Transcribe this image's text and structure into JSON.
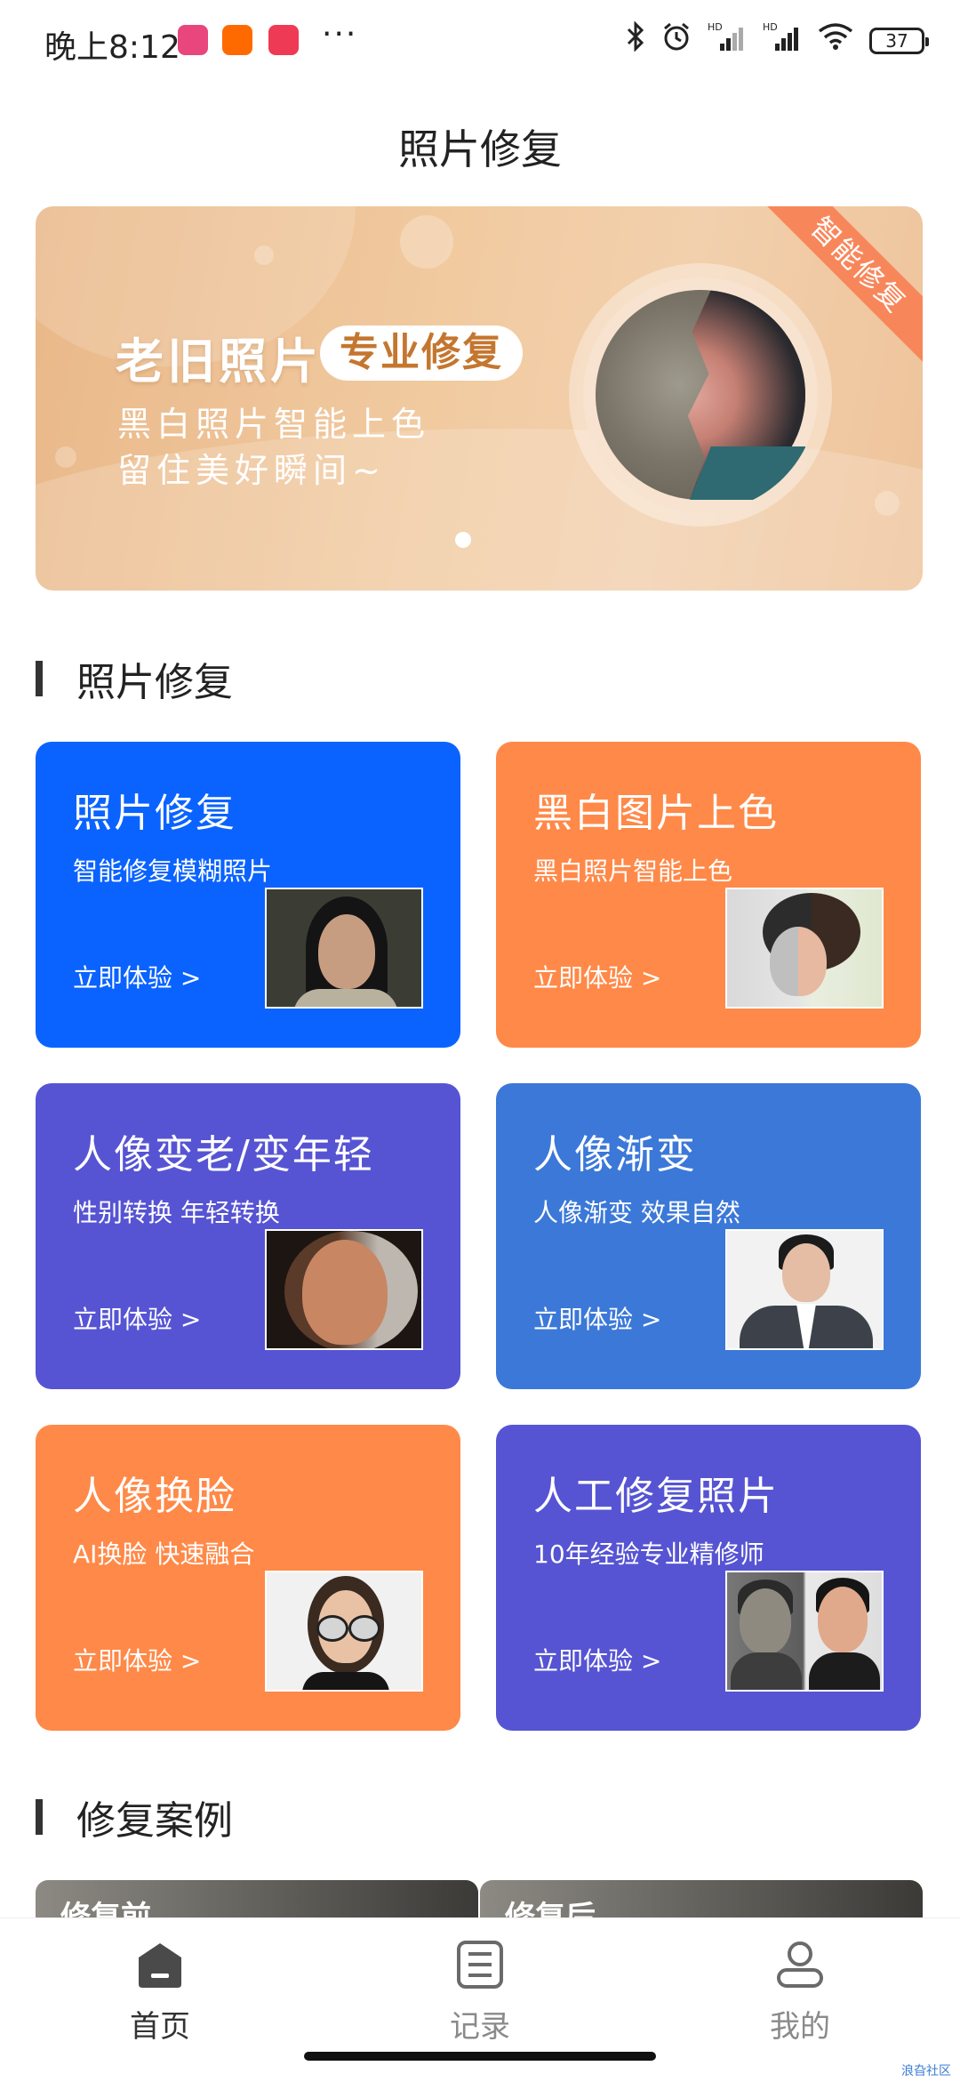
{
  "status_bar": {
    "time": "晚上8:12",
    "more": "···",
    "battery": "37",
    "icons": [
      "bluetooth-icon",
      "alarm-icon",
      "hd-signal-icon",
      "hd-signal-icon",
      "wifi-icon",
      "battery-icon"
    ]
  },
  "page": {
    "title": "照片修复"
  },
  "banner": {
    "title": "老旧照片",
    "pill": "专业修复",
    "line1": "黑白照片智能上色",
    "line2": "留住美好瞬间~",
    "ribbon": "智能修复",
    "colors": {
      "bg_start": "#e9b889",
      "bg_end": "#eec39a",
      "pill_text": "#c4762f",
      "ribbon": "#f7875b"
    }
  },
  "section_repair": {
    "title": "照片修复"
  },
  "cards": [
    {
      "title": "照片修复",
      "subtitle": "智能修复模糊照片",
      "cta": "立即体验 >",
      "color": "#0a63ff"
    },
    {
      "title": "黑白图片上色",
      "subtitle": "黑白照片智能上色",
      "cta": "立即体验 >",
      "color": "#ff8948"
    },
    {
      "title": "人像变老/变年轻",
      "subtitle": "性别转换 年轻转换",
      "cta": "立即体验 >",
      "color": "#5654d3"
    },
    {
      "title": "人像渐变",
      "subtitle": "人像渐变 效果自然",
      "cta": "立即体验 >",
      "color": "#3b78d8"
    },
    {
      "title": "人像换脸",
      "subtitle": "AI换脸 快速融合",
      "cta": "立即体验 >",
      "color": "#ff8948"
    },
    {
      "title": "人工修复照片",
      "subtitle": "10年经验专业精修师",
      "cta": "立即体验 >",
      "color": "#5654d3"
    }
  ],
  "section_cases": {
    "title": "修复案例"
  },
  "cases": {
    "before": "修复前",
    "after": "修复后"
  },
  "bottom_nav": {
    "items": [
      {
        "label": "首页",
        "icon": "home-icon",
        "active": true
      },
      {
        "label": "记录",
        "icon": "document-icon",
        "active": false
      },
      {
        "label": "我的",
        "icon": "person-icon",
        "active": false
      }
    ],
    "active_color": "#333333",
    "inactive_color": "#8a8a8a"
  },
  "watermark": "浪旮社区"
}
